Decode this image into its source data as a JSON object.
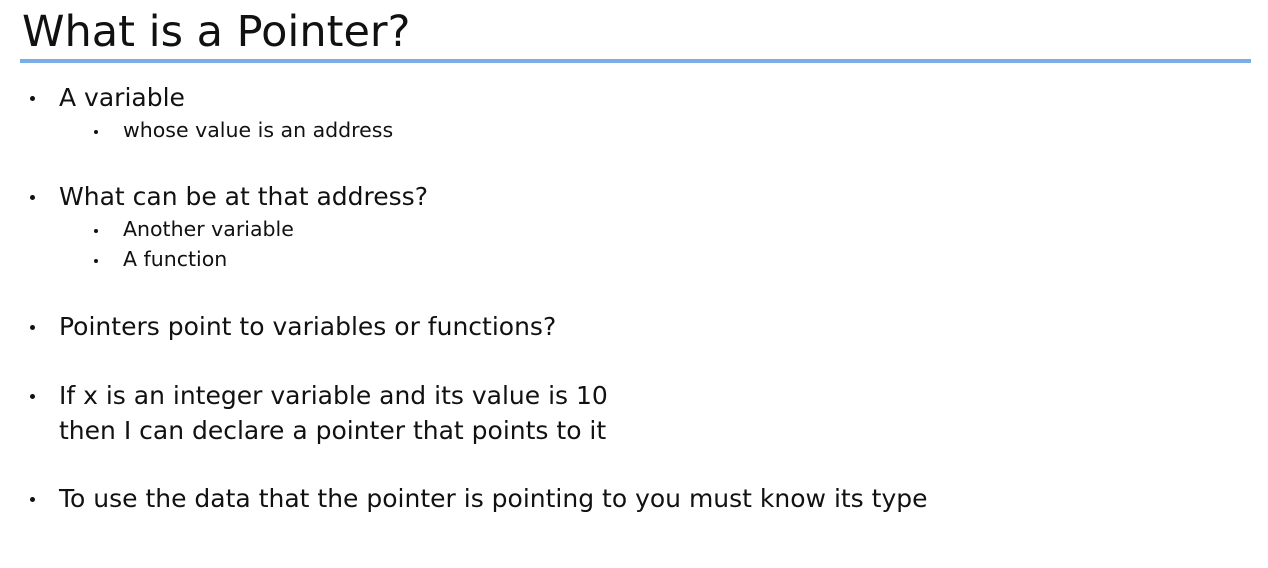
{
  "slide": {
    "title": "What is a Pointer?",
    "bullets": [
      {
        "text": "A variable",
        "sub": [
          "whose value is an address"
        ]
      },
      {
        "text": "What can be at that address?",
        "sub": [
          "Another variable",
          "A function"
        ]
      },
      {
        "text": "Pointers point to variables or functions?",
        "sub": []
      },
      {
        "text": "If x is an integer variable and its value is 10",
        "text_line2": "then I can declare a pointer that points to it",
        "sub": []
      },
      {
        "text": "To use the data that the pointer is pointing to you must know its type",
        "sub": []
      }
    ]
  },
  "colors": {
    "title_rule": "#7aaee6",
    "text": "#111111",
    "background": "#ffffff"
  }
}
